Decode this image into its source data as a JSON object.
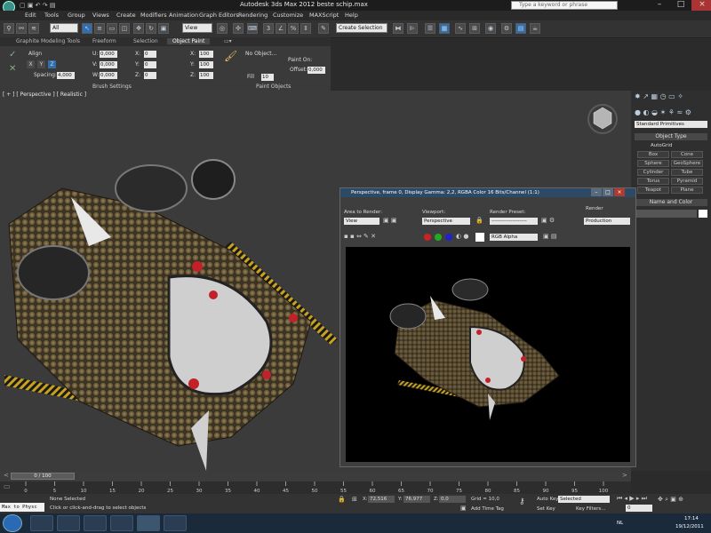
{
  "window": {
    "title": "Autodesk 3ds Max  2012      beste schip.max",
    "search_placeholder": "Type a keyword or phrase"
  },
  "menu": [
    "Edit",
    "Tools",
    "Group",
    "Views",
    "Create",
    "Modifiers",
    "Animation",
    "Graph Editors",
    "Rendering",
    "Customize",
    "MAXScript",
    "Help"
  ],
  "toolbar": {
    "selection_filter": "All",
    "reference_coord": "View",
    "named_selection": "Create Selection"
  },
  "ribbon": {
    "tabs": [
      "Graphite Modeling Tools",
      "Freeform",
      "Selection",
      "Object Paint"
    ],
    "active_tab": "Object Paint",
    "align_label": "Align",
    "axes": [
      "X",
      "Y",
      "Z"
    ],
    "spacing_label": "Spacing:",
    "spacing_value": "4,000",
    "uvw": [
      {
        "label": "U:",
        "value": "0,000"
      },
      {
        "label": "V:",
        "value": "0,000"
      },
      {
        "label": "W:",
        "value": "0,000"
      }
    ],
    "xyz_a": [
      {
        "label": "X:",
        "value": "0"
      },
      {
        "label": "Y:",
        "value": "0"
      },
      {
        "label": "Z:",
        "value": "0"
      }
    ],
    "xyz_b": [
      {
        "label": "X:",
        "value": "100"
      },
      {
        "label": "Y:",
        "value": "100"
      },
      {
        "label": "Z:",
        "value": "100"
      }
    ],
    "brush_settings": "Brush Settings",
    "no_object": "No Object...",
    "paint_on": "Paint On:",
    "offset_label": "Offset:",
    "offset_value": "0,000",
    "fill_label": "Fill",
    "fill_value": "10",
    "paint_objects": "Paint Objects"
  },
  "viewport": {
    "label": "[ + ] [ Perspective ] [ Realistic ]"
  },
  "command_panel": {
    "category": "Standard Primitives",
    "object_type_title": "Object Type",
    "autogrid": "AutoGrid",
    "objects": [
      "Box",
      "Cone",
      "Sphere",
      "GeoSphere",
      "Cylinder",
      "Tube",
      "Torus",
      "Pyramid",
      "Teapot",
      "Plane"
    ],
    "name_color_title": "Name and Color"
  },
  "render_window": {
    "title": "Perspective, frame 0, Display Gamma: 2,2, RGBA Color 16 Bits/Channel (1:1)",
    "area_label": "Area to Render:",
    "area_value": "View",
    "viewport_label": "Viewport:",
    "viewport_value": "Perspective",
    "preset_label": "Render Preset:",
    "preset_value": "--------------------",
    "render_label": "Render",
    "render_mode": "Production",
    "channel": "RGB Alpha"
  },
  "timeline": {
    "frame_slider": "0 / 100",
    "ticks": [
      "0",
      "5",
      "10",
      "15",
      "20",
      "25",
      "30",
      "35",
      "40",
      "45",
      "50",
      "55",
      "60",
      "65",
      "70",
      "75",
      "80",
      "85",
      "90",
      "95",
      "100"
    ]
  },
  "status": {
    "maxscript": "Max to Physc",
    "selected": "None Selected",
    "prompt": "Click or click-and-drag to select objects",
    "x_label": "X:",
    "x_value": "72,516",
    "y_label": "Y:",
    "y_value": "76,977",
    "z_label": "Z:",
    "z_value": "0,0",
    "grid": "Grid = 10,0",
    "add_time_tag": "Add Time Tag",
    "auto_key": "Auto Key",
    "auto_key_value": "Selected",
    "set_key": "Set Key",
    "key_filters": "Key Filters...",
    "frame": "0"
  },
  "taskbar": {
    "lang": "NL",
    "time": "17:14",
    "date": "19/12/2011"
  }
}
